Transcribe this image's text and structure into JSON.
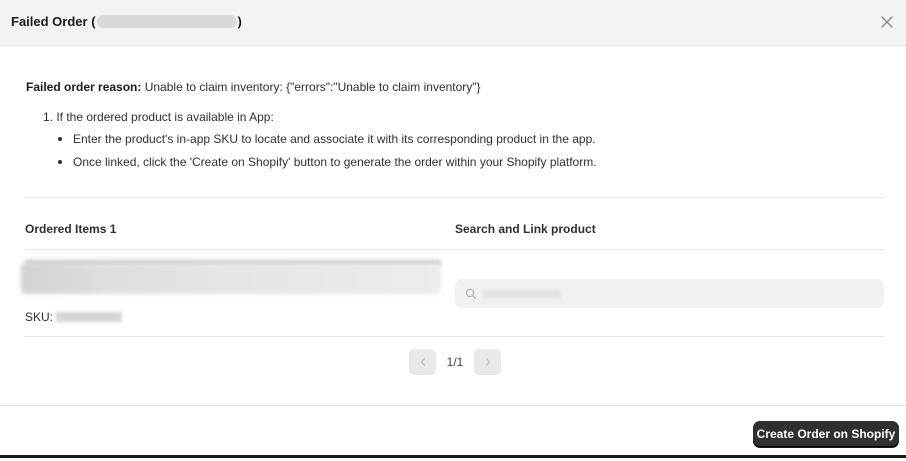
{
  "modal": {
    "title_prefix": "Failed Order (",
    "title_suffix": ")"
  },
  "reason": {
    "label": "Failed order reason:",
    "text": " Unable to claim inventory: {\"errors\":\"Unable to claim inventory\"}"
  },
  "instructions": {
    "step1": "1. If the ordered product is available in App:",
    "bullets": [
      "Enter the product's in-app SKU to locate and associate it with its corresponding product in the app.",
      "Once linked, click the 'Create on Shopify' button to generate the order within your Shopify platform."
    ]
  },
  "columns": {
    "ordered_items": "Ordered Items 1",
    "search_link": "Search and Link product"
  },
  "item": {
    "sku_label": "SKU:"
  },
  "pagination": {
    "label": "1/1"
  },
  "footer": {
    "create_button": "Create Order on Shopify"
  },
  "colors": {
    "primary_button": "#303030",
    "header_bg": "#f3f3f3"
  },
  "icons": {
    "close": "close-icon",
    "search": "search-icon",
    "prev": "chevron-left-icon",
    "next": "chevron-right-icon"
  }
}
